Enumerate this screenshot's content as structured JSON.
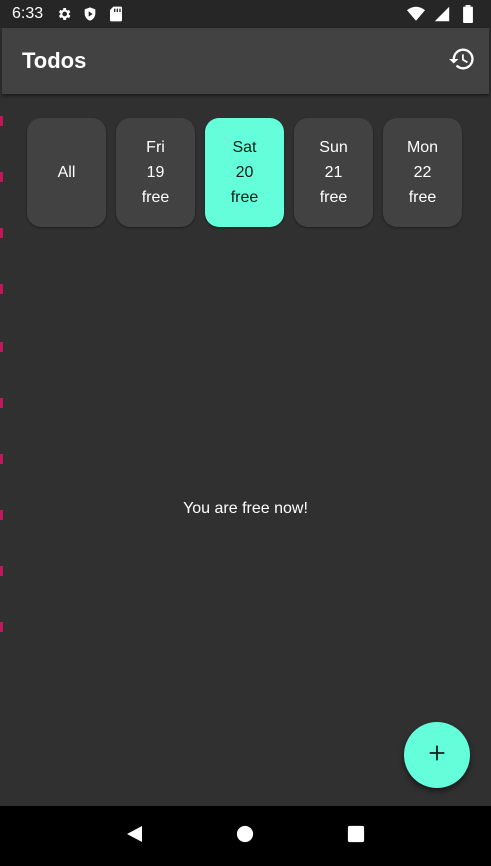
{
  "status_bar": {
    "time": "6:33",
    "left_icons": [
      "gear-icon",
      "shield-icon",
      "sd-card-icon"
    ],
    "right_icons": [
      "wifi-icon",
      "signal-icon",
      "battery-icon"
    ]
  },
  "app_bar": {
    "title": "Todos",
    "action_icon": "history-icon"
  },
  "day_chips": [
    {
      "lines": [
        "All"
      ],
      "selected": false
    },
    {
      "lines": [
        "Fri",
        "19",
        "free"
      ],
      "selected": false
    },
    {
      "lines": [
        "Sat",
        "20",
        "free"
      ],
      "selected": true
    },
    {
      "lines": [
        "Sun",
        "21",
        "free"
      ],
      "selected": false
    },
    {
      "lines": [
        "Mon",
        "22",
        "free"
      ],
      "selected": false
    }
  ],
  "empty_message": "You are free now!",
  "fab": {
    "icon": "plus-icon"
  },
  "nav_bar": {
    "buttons": [
      "back-icon",
      "home-icon",
      "recents-icon"
    ]
  },
  "colors": {
    "background": "#303030",
    "app_bar": "#424242",
    "accent": "#64ffda",
    "chip": "#424242",
    "edge_mark": "#c2185b"
  }
}
